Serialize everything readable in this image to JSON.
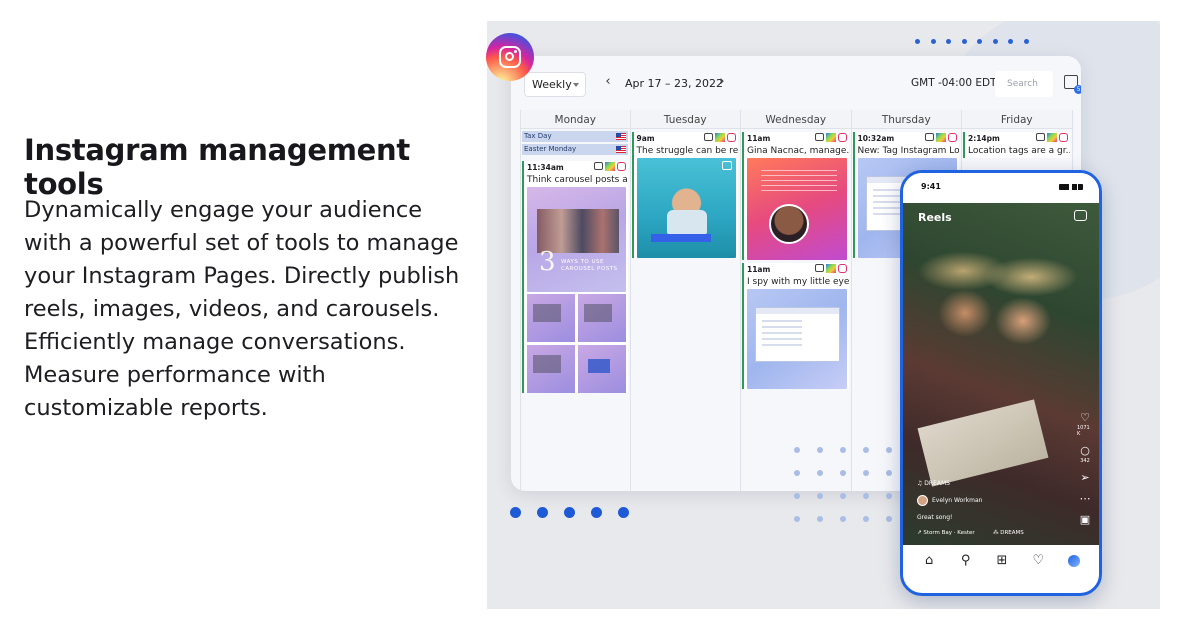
{
  "left": {
    "heading": "Instagram management tools",
    "description": "Dynamically engage your audience with a powerful set of tools to manage your Instagram Pages. Directly publish reels, images, videos, and carousels. Efficiently manage conversations. Measure performance with customizable reports."
  },
  "calendar": {
    "view": "Weekly",
    "date_range": "Apr 17 – 23, 2022",
    "timezone": "GMT -04:00 EDT",
    "search_placeholder": "Search",
    "badge_count": "5",
    "days": [
      "Monday",
      "Tuesday",
      "Wednesday",
      "Thursday",
      "Friday"
    ],
    "holidays": [
      "Tax Day",
      "Easter Monday"
    ],
    "posts": {
      "monday": {
        "time": "11:34am",
        "title": "Think carousel posts a...",
        "thumb_caption": "WAYS TO USE CAROUSEL POSTS",
        "thumb_number": "3"
      },
      "tuesday": {
        "time": "9am",
        "title": "The struggle can be re..."
      },
      "wednesday1": {
        "time": "11am",
        "title": "Gina Nacnac, manage..."
      },
      "wednesday2": {
        "time": "11am",
        "title": "I spy with my little eye ..."
      },
      "thursday": {
        "time": "10:32am",
        "title": "New: Tag Instagram Lo..."
      },
      "friday": {
        "time": "2:14pm",
        "title": "Location tags are a gr..."
      }
    }
  },
  "phone": {
    "time": "9:41",
    "screen_title": "Reels",
    "likes": "1071 K",
    "comments": "342",
    "tag": "DREAMS",
    "user": "Evelyn Workman",
    "caption": "Great song!",
    "audio": "Storm Bay · Kester",
    "audio2": "DREAMS"
  },
  "icons": {
    "instagram_logo": "instagram-logo",
    "nav_prev": "chevron-left-icon",
    "nav_next": "chevron-right-icon"
  },
  "colors": {
    "accent": "#1f63e0",
    "post_border": "#2d9a57",
    "instagram_pink": "#e1306c"
  }
}
